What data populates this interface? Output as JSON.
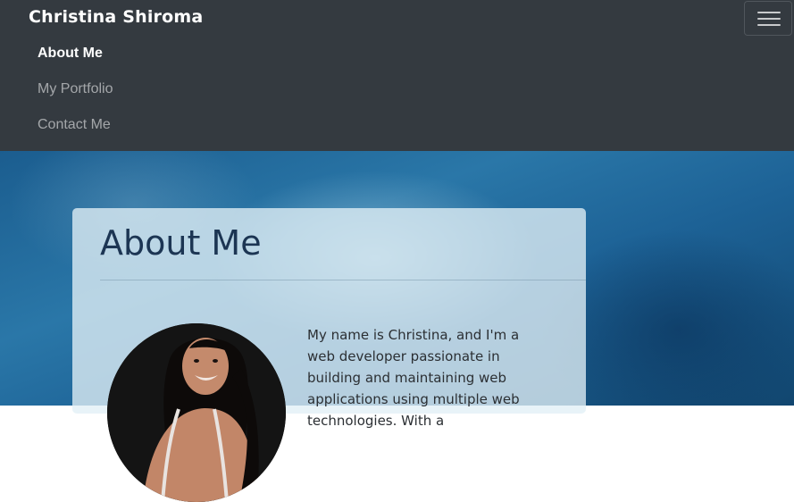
{
  "navbar": {
    "brand": "Christina Shiroma",
    "links": [
      {
        "label": "About Me",
        "active": true
      },
      {
        "label": "My Portfolio",
        "active": false
      },
      {
        "label": "Contact Me",
        "active": false
      }
    ],
    "toggler_icon": "hamburger-menu-icon",
    "background": "#343a40"
  },
  "about": {
    "title": "About Me",
    "bio": "My name is Christina, and I'm a web developer passionate in building and maintaining web applications using multiple web technologies. With a",
    "profile_photo": "profile-photo"
  }
}
